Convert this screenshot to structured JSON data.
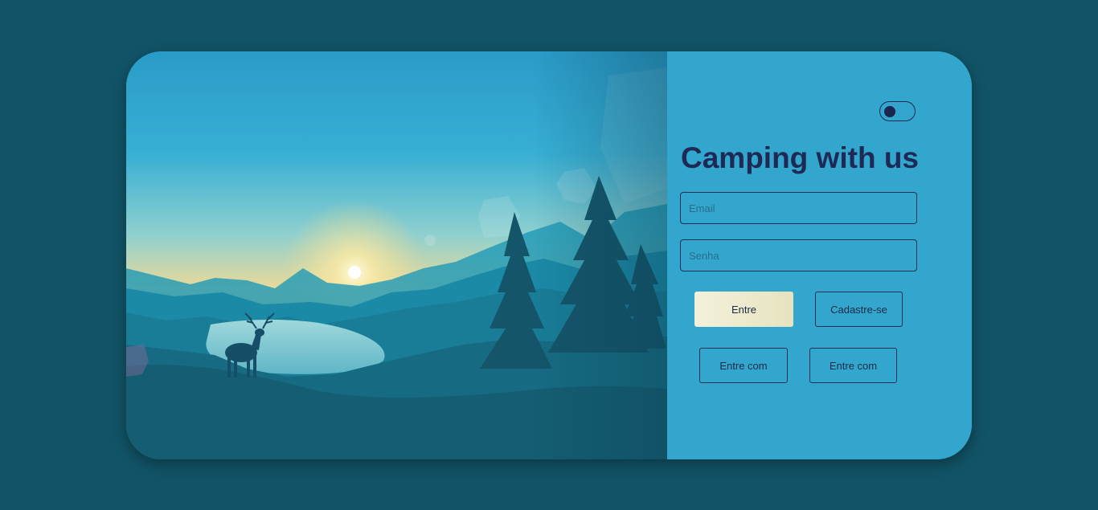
{
  "login": {
    "title": "Camping with us",
    "email_placeholder": "Email",
    "password_placeholder": "Senha",
    "login_button": "Entre",
    "signup_button": "Cadastre-se",
    "social_login_1": "Entre com",
    "social_login_2": "Entre com"
  },
  "theme_toggle": {
    "state": "off"
  },
  "colors": {
    "page_background": "#115467",
    "panel_background": "#32a6cd",
    "title_text": "#1e2a55",
    "primary_button": "#efecd0"
  },
  "illustration": {
    "subject": "forest-lake-landscape-with-deer-at-sunrise"
  }
}
